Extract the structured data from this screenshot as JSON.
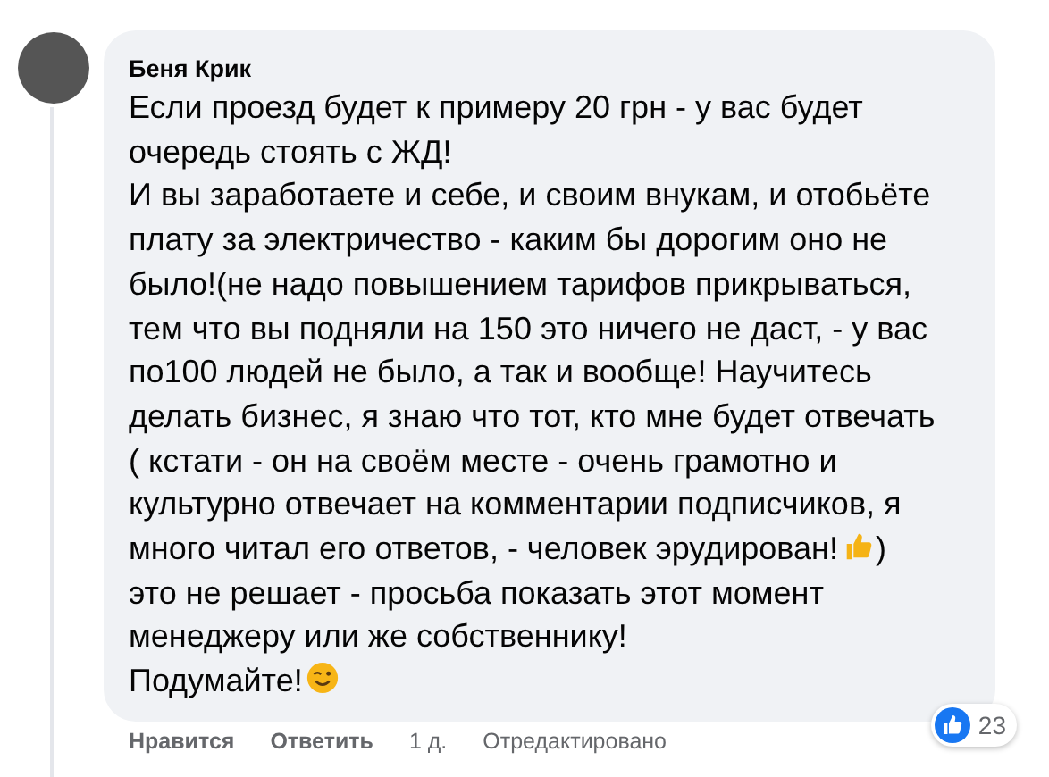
{
  "comment": {
    "author": "Беня Крик",
    "lines": [
      {
        "text": "Если проезд будет к примеру 20 грн - у вас будет",
        "kind": "plain"
      },
      {
        "text": "очередь стоять с ЖД!",
        "kind": "plain"
      },
      {
        "text": "И вы заработаете и себе, и своим внукам, и отобьёте",
        "kind": "plain"
      },
      {
        "text": "плату за электричество - каким бы дорогим оно не",
        "kind": "plain"
      },
      {
        "text": "было!(не надо повышением тарифов прикрываться,",
        "kind": "plain"
      },
      {
        "text": "тем что вы подняли на 150 это ничего не даст, - у вас",
        "kind": "plain"
      },
      {
        "text": "по100 людей не было, а так и вообще! Научитесь",
        "kind": "plain"
      },
      {
        "text": "делать бизнес, я знаю что тот, кто мне будет отвечать",
        "kind": "plain"
      },
      {
        "text": "( кстати - он на своём месте - очень грамотно и",
        "kind": "plain"
      },
      {
        "text": "культурно отвечает на комментарии подписчиков, я",
        "kind": "plain"
      },
      {
        "text": "много читал его ответов, - человек эрудирован!",
        "kind": "thumbs-up",
        "after": ")"
      },
      {
        "text": "это не решает - просьба показать этот момент",
        "kind": "plain"
      },
      {
        "text": "менеджеру или же собственнику!",
        "kind": "plain"
      },
      {
        "text": "Подумайте!",
        "kind": "wink"
      }
    ],
    "reactions": {
      "count": "23"
    },
    "actions": [
      {
        "label": "Нравится",
        "kind": "link"
      },
      {
        "label": "Ответить",
        "kind": "link"
      },
      {
        "label": "1 д.",
        "kind": "meta"
      },
      {
        "label": "Отредактировано",
        "kind": "meta"
      }
    ]
  }
}
